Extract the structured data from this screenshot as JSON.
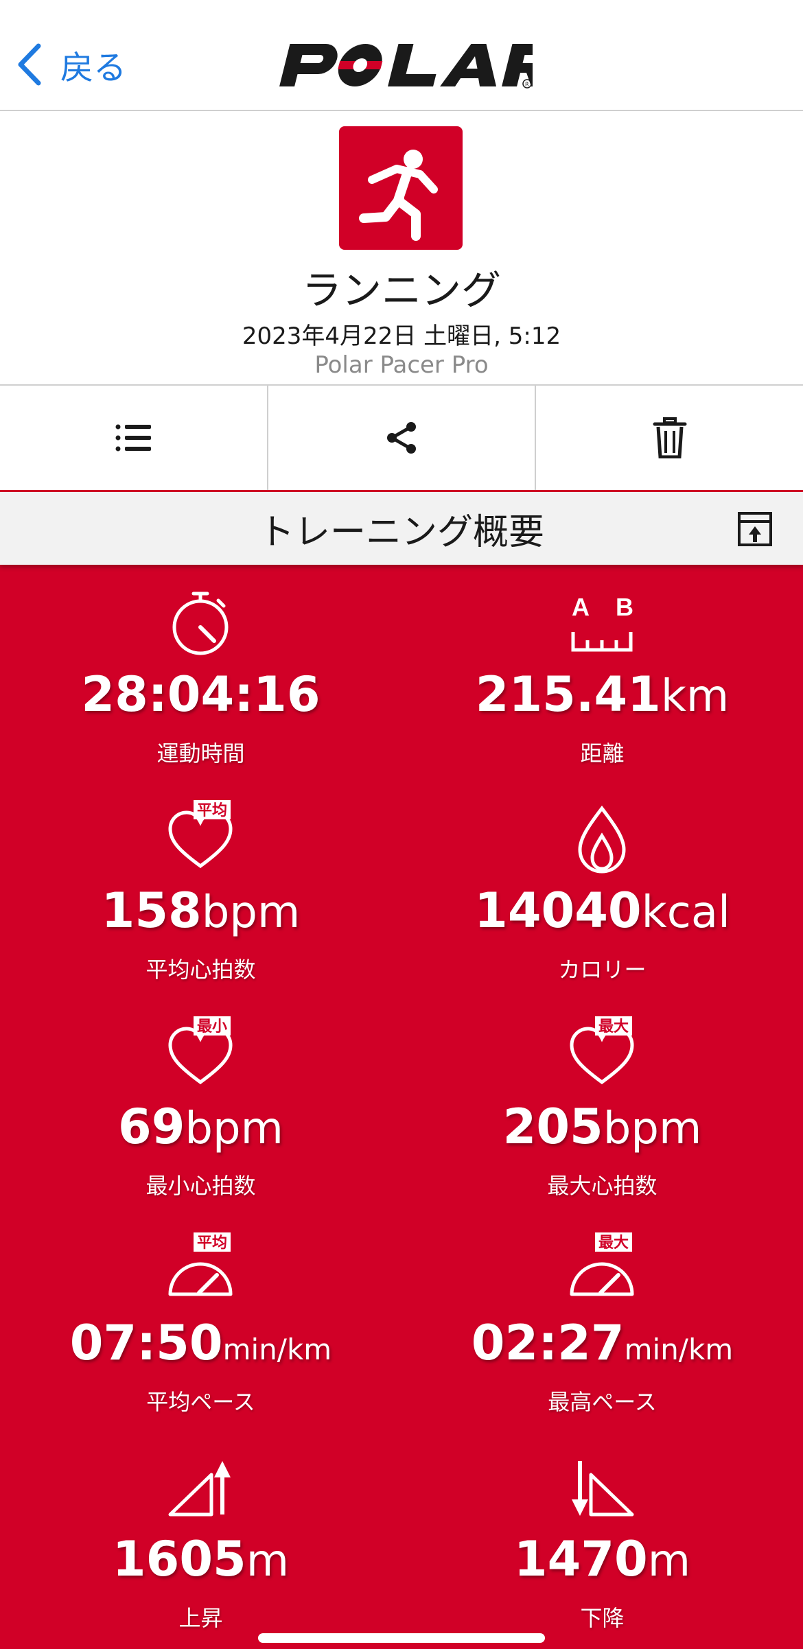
{
  "nav": {
    "back_label": "戻る",
    "brand": "POLAR"
  },
  "activity": {
    "sport_icon": "running-icon",
    "title": "ランニング",
    "datetime": "2023年4月22日 土曜日, 5:12",
    "device": "Polar Pacer Pro"
  },
  "actions": [
    {
      "icon": "list-icon"
    },
    {
      "icon": "share-icon"
    },
    {
      "icon": "trash-icon"
    }
  ],
  "section": {
    "title": "トレーニング概要",
    "action_icon": "export-icon"
  },
  "stats": [
    {
      "icon": "stopwatch-icon",
      "value": "28:04:16",
      "unit": "",
      "label": "運動時間"
    },
    {
      "icon": "distance-icon",
      "icon_text": [
        "A",
        "B"
      ],
      "value": "215.41",
      "unit": "km",
      "label": "距離"
    },
    {
      "icon": "heart-avg-icon",
      "badge": "平均",
      "value": "158",
      "unit": "bpm",
      "label": "平均心拍数"
    },
    {
      "icon": "flame-icon",
      "value": "14040",
      "unit": "kcal",
      "label": "カロリー"
    },
    {
      "icon": "heart-min-icon",
      "badge": "最小",
      "value": "69",
      "unit": "bpm",
      "label": "最小心拍数"
    },
    {
      "icon": "heart-max-icon",
      "badge": "最大",
      "value": "205",
      "unit": "bpm",
      "label": "最大心拍数"
    },
    {
      "icon": "pace-avg-icon",
      "badge": "平均",
      "value": "07:50",
      "unit": "min/km",
      "label": "平均ペース"
    },
    {
      "icon": "pace-max-icon",
      "badge": "最大",
      "value": "02:27",
      "unit": "min/km",
      "label": "最高ペース"
    },
    {
      "icon": "ascent-icon",
      "value": "1605",
      "unit": "m",
      "label": "上昇"
    },
    {
      "icon": "descent-icon",
      "value": "1470",
      "unit": "m",
      "label": "下降"
    }
  ],
  "colors": {
    "accent": "#d10027",
    "link": "#1f7ae0"
  }
}
